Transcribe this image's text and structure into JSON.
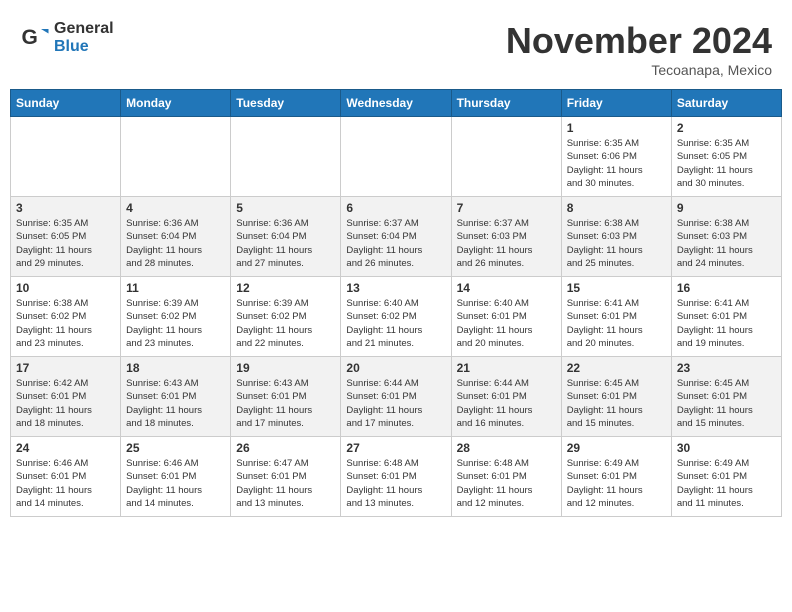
{
  "header": {
    "logo_line1": "General",
    "logo_line2": "Blue",
    "month_title": "November 2024",
    "location": "Tecoanapa, Mexico"
  },
  "weekdays": [
    "Sunday",
    "Monday",
    "Tuesday",
    "Wednesday",
    "Thursday",
    "Friday",
    "Saturday"
  ],
  "weeks": [
    [
      {
        "day": "",
        "info": ""
      },
      {
        "day": "",
        "info": ""
      },
      {
        "day": "",
        "info": ""
      },
      {
        "day": "",
        "info": ""
      },
      {
        "day": "",
        "info": ""
      },
      {
        "day": "1",
        "info": "Sunrise: 6:35 AM\nSunset: 6:06 PM\nDaylight: 11 hours\nand 30 minutes."
      },
      {
        "day": "2",
        "info": "Sunrise: 6:35 AM\nSunset: 6:05 PM\nDaylight: 11 hours\nand 30 minutes."
      }
    ],
    [
      {
        "day": "3",
        "info": "Sunrise: 6:35 AM\nSunset: 6:05 PM\nDaylight: 11 hours\nand 29 minutes."
      },
      {
        "day": "4",
        "info": "Sunrise: 6:36 AM\nSunset: 6:04 PM\nDaylight: 11 hours\nand 28 minutes."
      },
      {
        "day": "5",
        "info": "Sunrise: 6:36 AM\nSunset: 6:04 PM\nDaylight: 11 hours\nand 27 minutes."
      },
      {
        "day": "6",
        "info": "Sunrise: 6:37 AM\nSunset: 6:04 PM\nDaylight: 11 hours\nand 26 minutes."
      },
      {
        "day": "7",
        "info": "Sunrise: 6:37 AM\nSunset: 6:03 PM\nDaylight: 11 hours\nand 26 minutes."
      },
      {
        "day": "8",
        "info": "Sunrise: 6:38 AM\nSunset: 6:03 PM\nDaylight: 11 hours\nand 25 minutes."
      },
      {
        "day": "9",
        "info": "Sunrise: 6:38 AM\nSunset: 6:03 PM\nDaylight: 11 hours\nand 24 minutes."
      }
    ],
    [
      {
        "day": "10",
        "info": "Sunrise: 6:38 AM\nSunset: 6:02 PM\nDaylight: 11 hours\nand 23 minutes."
      },
      {
        "day": "11",
        "info": "Sunrise: 6:39 AM\nSunset: 6:02 PM\nDaylight: 11 hours\nand 23 minutes."
      },
      {
        "day": "12",
        "info": "Sunrise: 6:39 AM\nSunset: 6:02 PM\nDaylight: 11 hours\nand 22 minutes."
      },
      {
        "day": "13",
        "info": "Sunrise: 6:40 AM\nSunset: 6:02 PM\nDaylight: 11 hours\nand 21 minutes."
      },
      {
        "day": "14",
        "info": "Sunrise: 6:40 AM\nSunset: 6:01 PM\nDaylight: 11 hours\nand 20 minutes."
      },
      {
        "day": "15",
        "info": "Sunrise: 6:41 AM\nSunset: 6:01 PM\nDaylight: 11 hours\nand 20 minutes."
      },
      {
        "day": "16",
        "info": "Sunrise: 6:41 AM\nSunset: 6:01 PM\nDaylight: 11 hours\nand 19 minutes."
      }
    ],
    [
      {
        "day": "17",
        "info": "Sunrise: 6:42 AM\nSunset: 6:01 PM\nDaylight: 11 hours\nand 18 minutes."
      },
      {
        "day": "18",
        "info": "Sunrise: 6:43 AM\nSunset: 6:01 PM\nDaylight: 11 hours\nand 18 minutes."
      },
      {
        "day": "19",
        "info": "Sunrise: 6:43 AM\nSunset: 6:01 PM\nDaylight: 11 hours\nand 17 minutes."
      },
      {
        "day": "20",
        "info": "Sunrise: 6:44 AM\nSunset: 6:01 PM\nDaylight: 11 hours\nand 17 minutes."
      },
      {
        "day": "21",
        "info": "Sunrise: 6:44 AM\nSunset: 6:01 PM\nDaylight: 11 hours\nand 16 minutes."
      },
      {
        "day": "22",
        "info": "Sunrise: 6:45 AM\nSunset: 6:01 PM\nDaylight: 11 hours\nand 15 minutes."
      },
      {
        "day": "23",
        "info": "Sunrise: 6:45 AM\nSunset: 6:01 PM\nDaylight: 11 hours\nand 15 minutes."
      }
    ],
    [
      {
        "day": "24",
        "info": "Sunrise: 6:46 AM\nSunset: 6:01 PM\nDaylight: 11 hours\nand 14 minutes."
      },
      {
        "day": "25",
        "info": "Sunrise: 6:46 AM\nSunset: 6:01 PM\nDaylight: 11 hours\nand 14 minutes."
      },
      {
        "day": "26",
        "info": "Sunrise: 6:47 AM\nSunset: 6:01 PM\nDaylight: 11 hours\nand 13 minutes."
      },
      {
        "day": "27",
        "info": "Sunrise: 6:48 AM\nSunset: 6:01 PM\nDaylight: 11 hours\nand 13 minutes."
      },
      {
        "day": "28",
        "info": "Sunrise: 6:48 AM\nSunset: 6:01 PM\nDaylight: 11 hours\nand 12 minutes."
      },
      {
        "day": "29",
        "info": "Sunrise: 6:49 AM\nSunset: 6:01 PM\nDaylight: 11 hours\nand 12 minutes."
      },
      {
        "day": "30",
        "info": "Sunrise: 6:49 AM\nSunset: 6:01 PM\nDaylight: 11 hours\nand 11 minutes."
      }
    ]
  ]
}
